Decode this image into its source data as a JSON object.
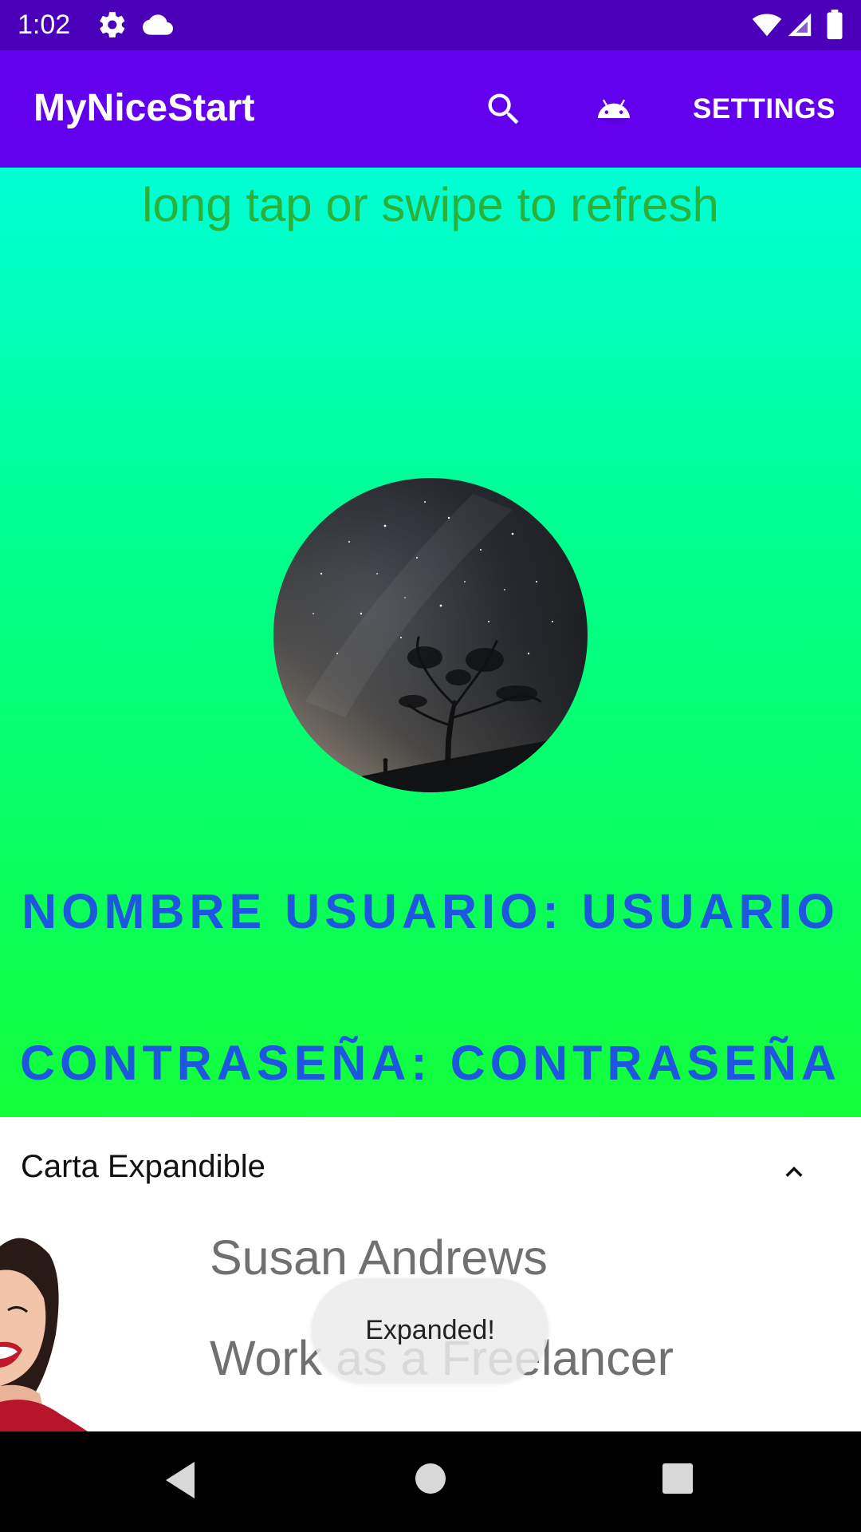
{
  "status_bar": {
    "time": "1:02",
    "icons": [
      "gear-icon",
      "cloud-icon",
      "wifi-icon",
      "signal-icon",
      "battery-icon"
    ]
  },
  "app_bar": {
    "title": "MyNiceStart",
    "actions": [
      "search-icon",
      "android-icon"
    ],
    "settings_label": "SETTINGS",
    "color": "#6200ee"
  },
  "content": {
    "refresh_hint": "long tap or swipe to refresh",
    "user_label": "NOMBRE USUARIO: USUARIO",
    "password_label": "CONTRASEÑA: CONTRASEÑA",
    "accent_text_color": "#1e56e0",
    "hint_color": "#2bb13a"
  },
  "card": {
    "title": "Carta Expandible",
    "name": "Susan Andrews",
    "role": "Work as a Freelancer",
    "expanded": true
  },
  "toast": {
    "message": "Expanded!"
  },
  "nav_bar": {
    "buttons": [
      "back-icon",
      "home-icon",
      "recents-icon"
    ]
  }
}
